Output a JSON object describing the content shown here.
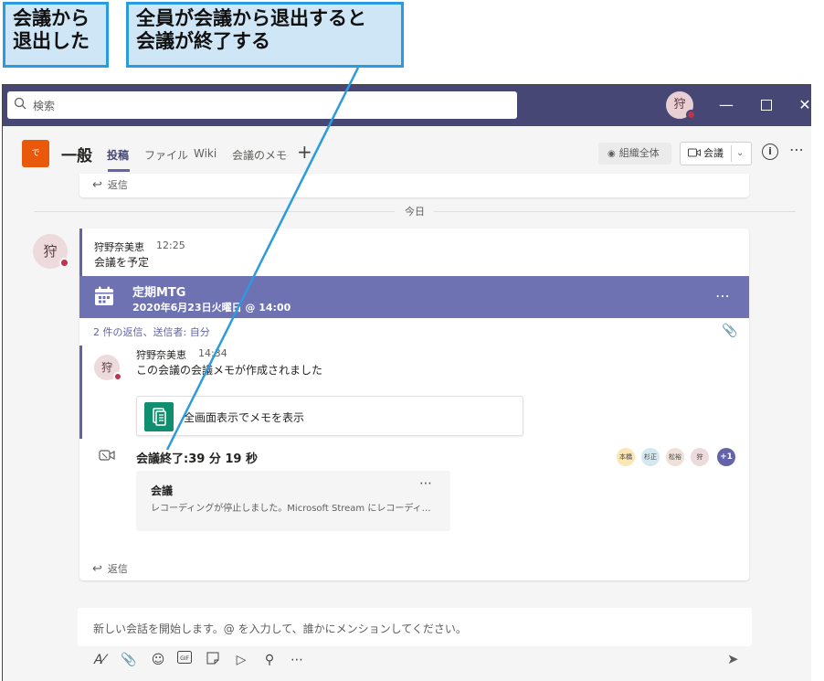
{
  "callouts": {
    "left": {
      "line1": "会議から",
      "line2": "退出した"
    },
    "right": {
      "line1": "全員が会議から退出すると",
      "line2": "会議が終了する"
    }
  },
  "titlebar": {
    "search_placeholder": "検索",
    "avatar_initial": "狩"
  },
  "channel": {
    "team_initial": "で",
    "name": "一般",
    "tabs": [
      "投稿",
      "ファイル",
      "Wiki",
      "会議のメモ"
    ],
    "add_tab_icon": "+",
    "org_label": "組織全体",
    "meet_label": "会議"
  },
  "feed": {
    "reply_label": "返信",
    "divider_label": "今日",
    "post": {
      "author": "狩野奈美恵",
      "time": "12:25",
      "body": "会議を予定",
      "avatar_initial": "狩",
      "meeting": {
        "title": "定期MTG",
        "datetime": "2020年6月23日火曜日 @ 14:00"
      },
      "replies_summary": "2 件の返信、送信者: 自分"
    },
    "reply": {
      "author": "狩野奈美恵",
      "time": "14:34",
      "avatar_initial": "狩",
      "body": "この会議の会議メモが作成されました",
      "card_text": "全画面表示でメモを表示"
    },
    "meeting_end": {
      "text": "会議終了:39 分 19 秒",
      "participants": [
        {
          "label": "本橋",
          "color": "#fbe6b6"
        },
        {
          "label": "杉正",
          "color": "#d4e8ef"
        },
        {
          "label": "松裕",
          "color": "#efe0d8"
        },
        {
          "label": "狩",
          "color": "#ecdadc"
        }
      ],
      "more_count": "+1"
    },
    "recording": {
      "title": "会議",
      "description": "レコーディングが停止しました。Microsoft Stream にレコーディングを..."
    }
  },
  "compose": {
    "placeholder": "新しい会話を開始します。@ を入力して、誰かにメンションしてください。"
  },
  "colors": {
    "brand": "#464775",
    "accent": "#6264a7",
    "banner": "#6e72b3",
    "status_busy": "#c4314b"
  }
}
